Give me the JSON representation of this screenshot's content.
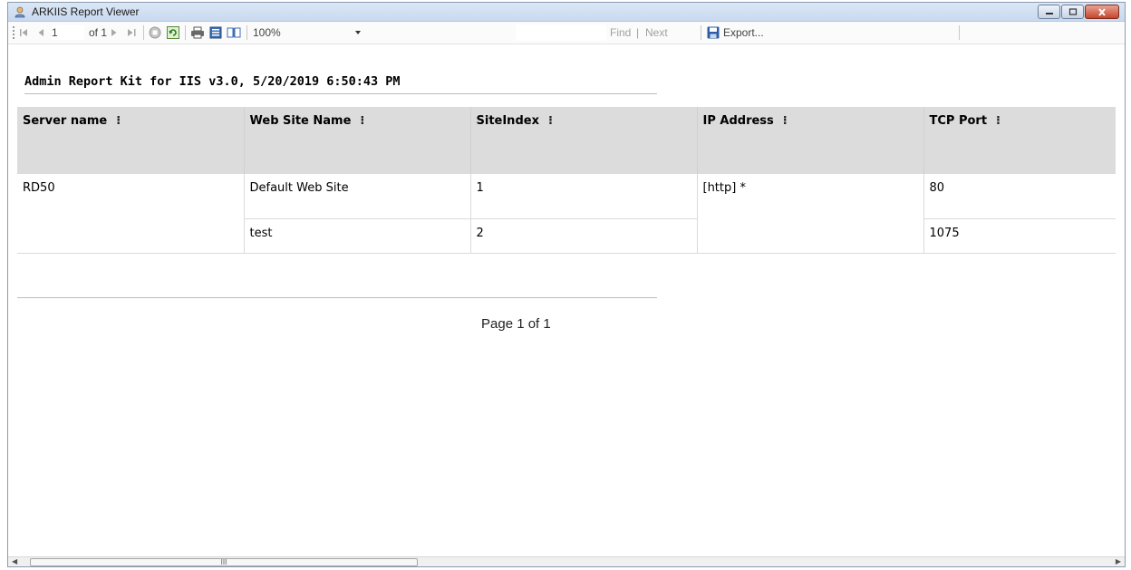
{
  "window": {
    "title": "ARKIIS Report Viewer",
    "icon": "user-report-icon"
  },
  "toolbar": {
    "first_page": "⏮",
    "prev_page": "◀",
    "page_number": "1",
    "page_of": "of 1",
    "next_page": "▶",
    "last_page": "⏭",
    "zoom": "100%",
    "find_label": "Find",
    "find_sep": "|",
    "next_label": "Next",
    "export_label": "Export..."
  },
  "report": {
    "title": "Admin Report Kit for IIS v3.0, 5/20/2019 6:50:43 PM",
    "columns": [
      "Server name",
      "Web Site Name",
      "SiteIndex",
      "IP Address",
      "TCP Port"
    ],
    "sort_glyph": "⁝",
    "rows": [
      {
        "server": "RD50",
        "site": "Default Web Site",
        "index": "1",
        "ip": "[http] *",
        "port": "80"
      },
      {
        "server": "",
        "site": "test",
        "index": "2",
        "ip": "",
        "port": "1075"
      }
    ],
    "page_label": "Page  1 of  1"
  },
  "scrollbar": {
    "grip": "III"
  }
}
